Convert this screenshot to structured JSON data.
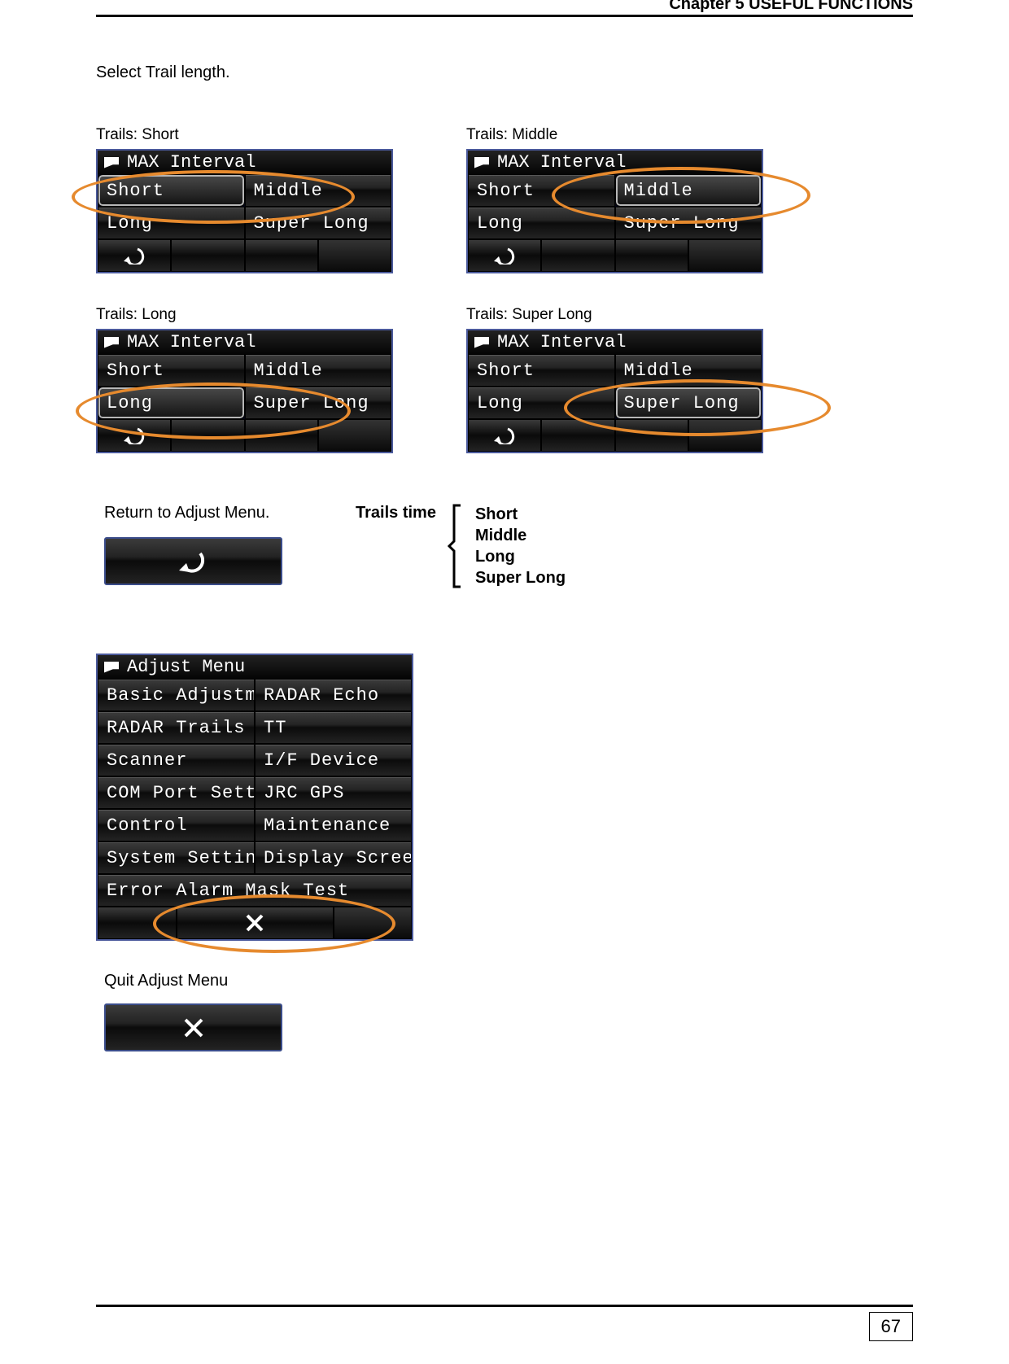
{
  "header": {
    "chapter": "Chapter 5    USEFUL FUNCTIONS"
  },
  "instruction": "Select Trail length.",
  "captions": {
    "short": "Trails: Short",
    "middle": "Trails: Middle",
    "long": "Trails: Long",
    "superlong": "Trails: Super Long",
    "return": "Return to Adjust Menu.",
    "quit": "Quit Adjust Menu"
  },
  "menu_max_interval": {
    "title": "MAX Interval",
    "items": [
      "Short",
      "Middle",
      "Long",
      "Super Long"
    ]
  },
  "trails_time": {
    "label": "Trails time",
    "options": [
      "Short",
      "Middle",
      "Long",
      "Super Long"
    ]
  },
  "adjust_menu": {
    "title": "Adjust Menu",
    "items": [
      "Basic Adjustment",
      "RADAR Echo",
      "RADAR Trails",
      "TT",
      "Scanner",
      "I/F Device",
      "COM Port Setting",
      "JRC GPS",
      "Control",
      "Maintenance",
      "System Setting",
      "Display Screen",
      "Error Alarm Mask Test"
    ]
  },
  "page_number": "67"
}
